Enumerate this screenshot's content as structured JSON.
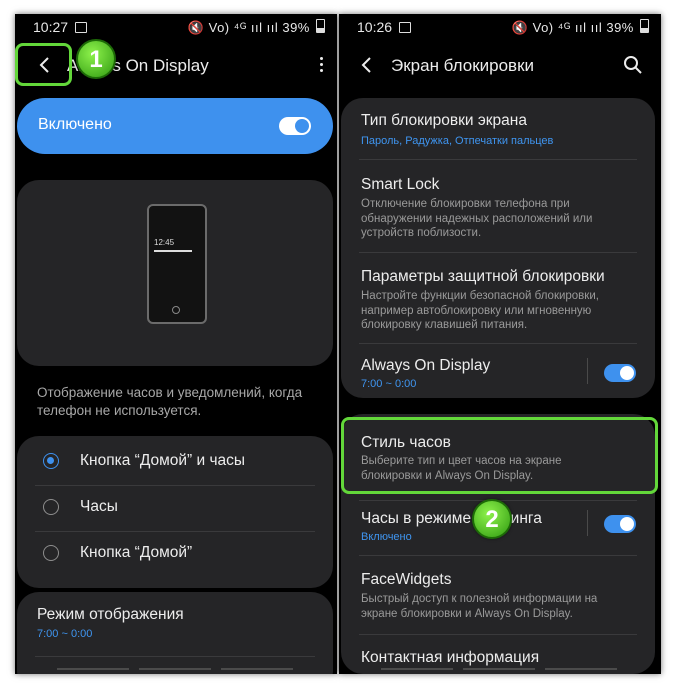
{
  "left": {
    "status": {
      "time": "10:27",
      "icons": "🔇 Vo) ⁴ᴳ ııl ııl",
      "battery": "39%"
    },
    "header": {
      "title": "Always On Display"
    },
    "toggle_card": {
      "label": "Включено"
    },
    "preview": {
      "clock": "12:45"
    },
    "description": "Отображение часов и уведомлений, когда телефон не используется.",
    "options": [
      {
        "label": "Кнопка “Домой” и часы",
        "selected": true
      },
      {
        "label": "Часы",
        "selected": false
      },
      {
        "label": "Кнопка “Домой”",
        "selected": false
      }
    ],
    "mode": {
      "title": "Режим отображения",
      "value": "7:00 ~ 0:00"
    },
    "badge": "1"
  },
  "right": {
    "status": {
      "time": "10:26",
      "icons": "🔇 Vo) ⁴ᴳ ııl ııl",
      "battery": "39%"
    },
    "header": {
      "title": "Экран блокировки"
    },
    "items": [
      {
        "title": "Тип блокировки экрана",
        "blue": "Пароль, Радужка, Отпечатки пальцев"
      },
      {
        "title": "Smart Lock",
        "sub": "Отключение блокировки телефона при обнаружении надежных расположений или устройств поблизости."
      },
      {
        "title": "Параметры защитной блокировки",
        "sub": "Настройте функции безопасной блокировки, например автоблокировку или мгновенную блокировку клавишей питания."
      },
      {
        "title": "Always On Display",
        "blue": "7:00 ~ 0:00"
      },
      {
        "title": "Стиль часов",
        "sub": "Выберите тип и цвет часов на экране блокировки и Always On Display."
      },
      {
        "title": "Часы в режиме роуминга",
        "blue": "Включено"
      },
      {
        "title": "FaceWidgets",
        "sub": "Быстрый доступ к полезной информации на экране блокировки и Always On Display."
      },
      {
        "title": "Контактная информация"
      }
    ],
    "badge": "2"
  },
  "colors": {
    "accent": "#3e91ee",
    "highlight": "#63d73a",
    "card": "#252527"
  }
}
